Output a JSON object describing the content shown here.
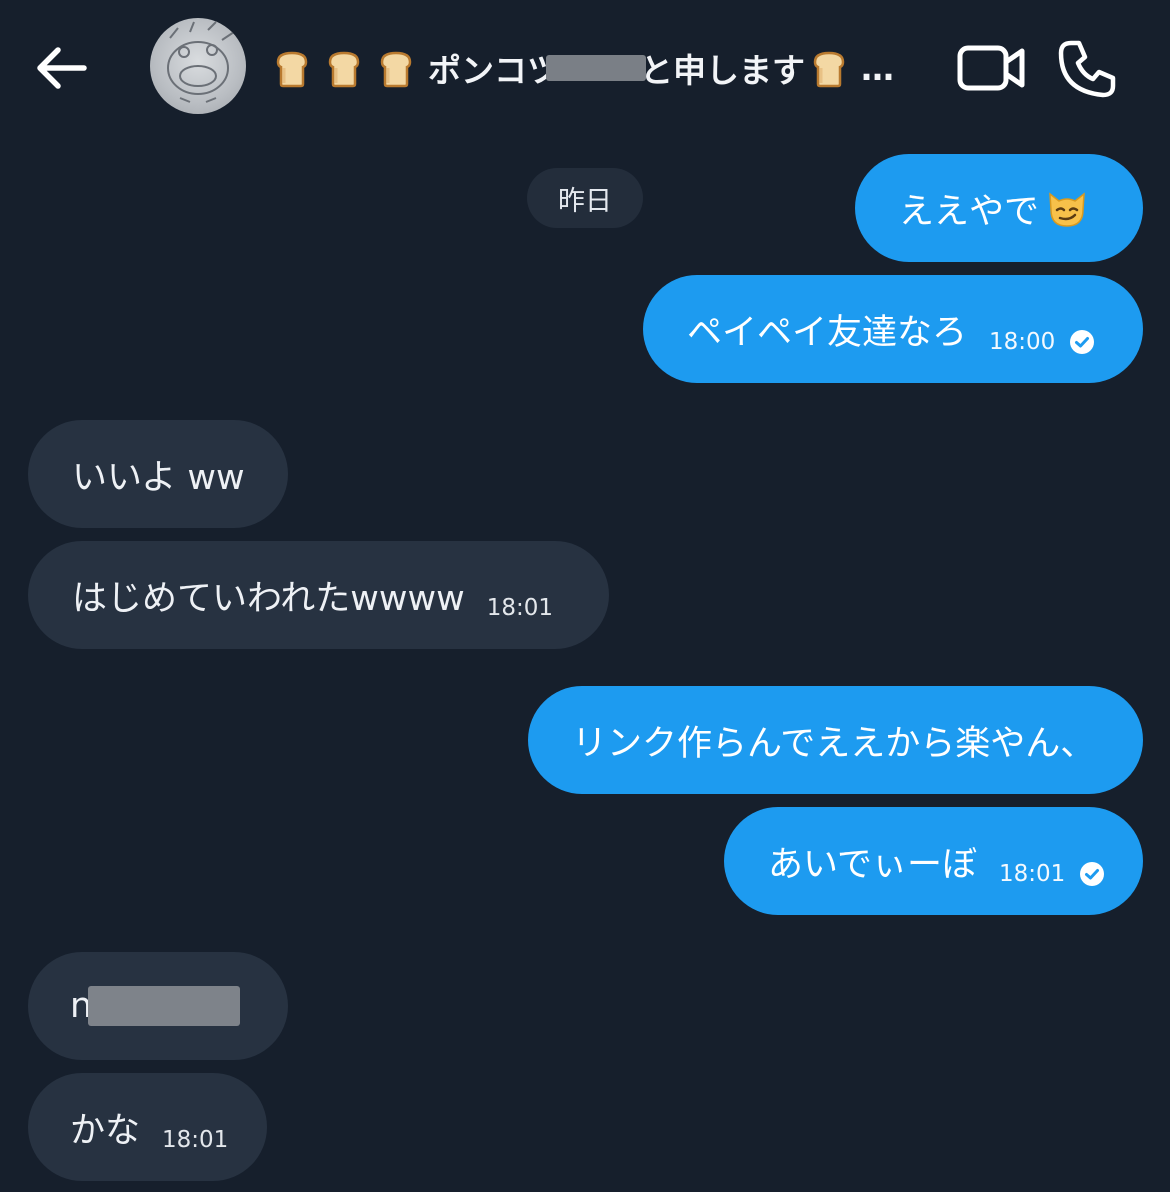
{
  "header": {
    "title_prefix": "ポンコツ",
    "title_suffix": "と申します",
    "title_ellipsis": "…",
    "icons": [
      "back-arrow-icon",
      "avatar",
      "bread-emoji-icon",
      "video-call-icon",
      "phone-call-icon"
    ]
  },
  "date_chip": "昨日",
  "messages": [
    {
      "dir": "out",
      "text": "ええやで",
      "emoji": "smirking-cat-emoji"
    },
    {
      "dir": "out",
      "text": "ペイペイ友達なろ",
      "time": "18:00",
      "read": true
    },
    {
      "dir": "in",
      "text": "いいよ ww"
    },
    {
      "dir": "in",
      "text": "はじめていわれたwwww",
      "time": "18:01"
    },
    {
      "dir": "out",
      "text": "リンク作らんでええから楽やん、"
    },
    {
      "dir": "out",
      "text": "あいでぃーぼ",
      "time": "18:01",
      "read": true
    },
    {
      "dir": "in",
      "text": "n"
    },
    {
      "dir": "in",
      "text": "かな",
      "time": "18:01"
    }
  ],
  "colors": {
    "background": "#161f2c",
    "outgoing_bubble": "#1d9bf0",
    "incoming_bubble": "#273241",
    "date_chip": "#232d3b"
  }
}
